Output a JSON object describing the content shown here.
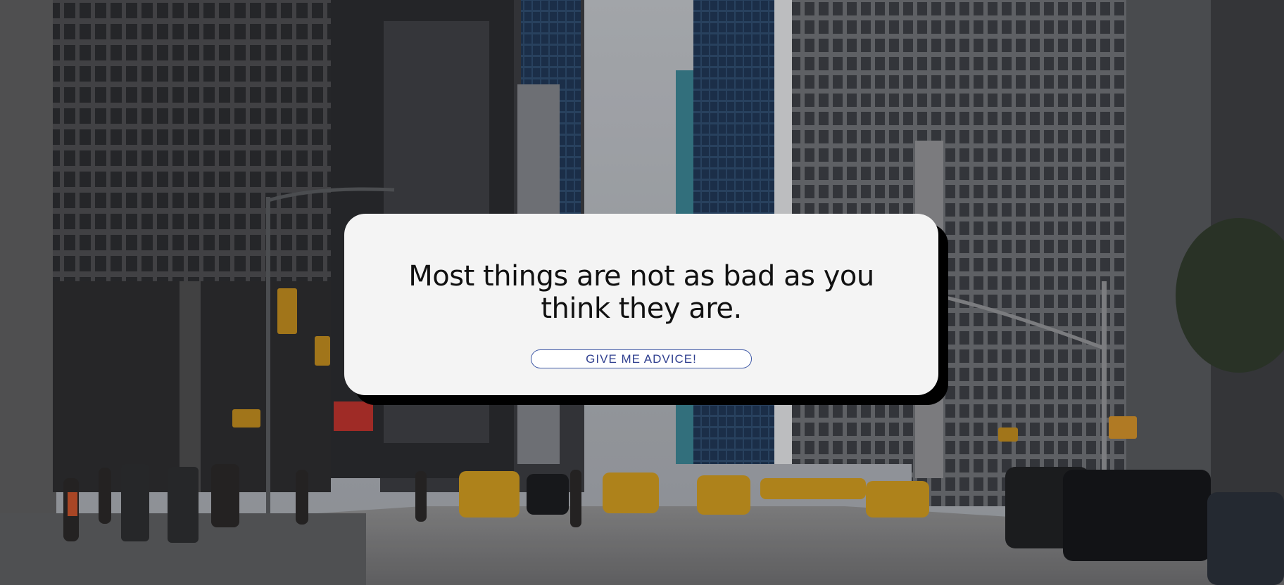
{
  "quote": {
    "text": "Most things are not as bad as you think they are."
  },
  "button": {
    "label": "GIVE ME ADVICE!"
  },
  "background": {
    "scene": "city-street-photo"
  },
  "colors": {
    "card_background": "#f4f4f4",
    "card_shadow": "#000000",
    "button_border": "#3a55a4",
    "button_text": "#2f3f8f"
  }
}
